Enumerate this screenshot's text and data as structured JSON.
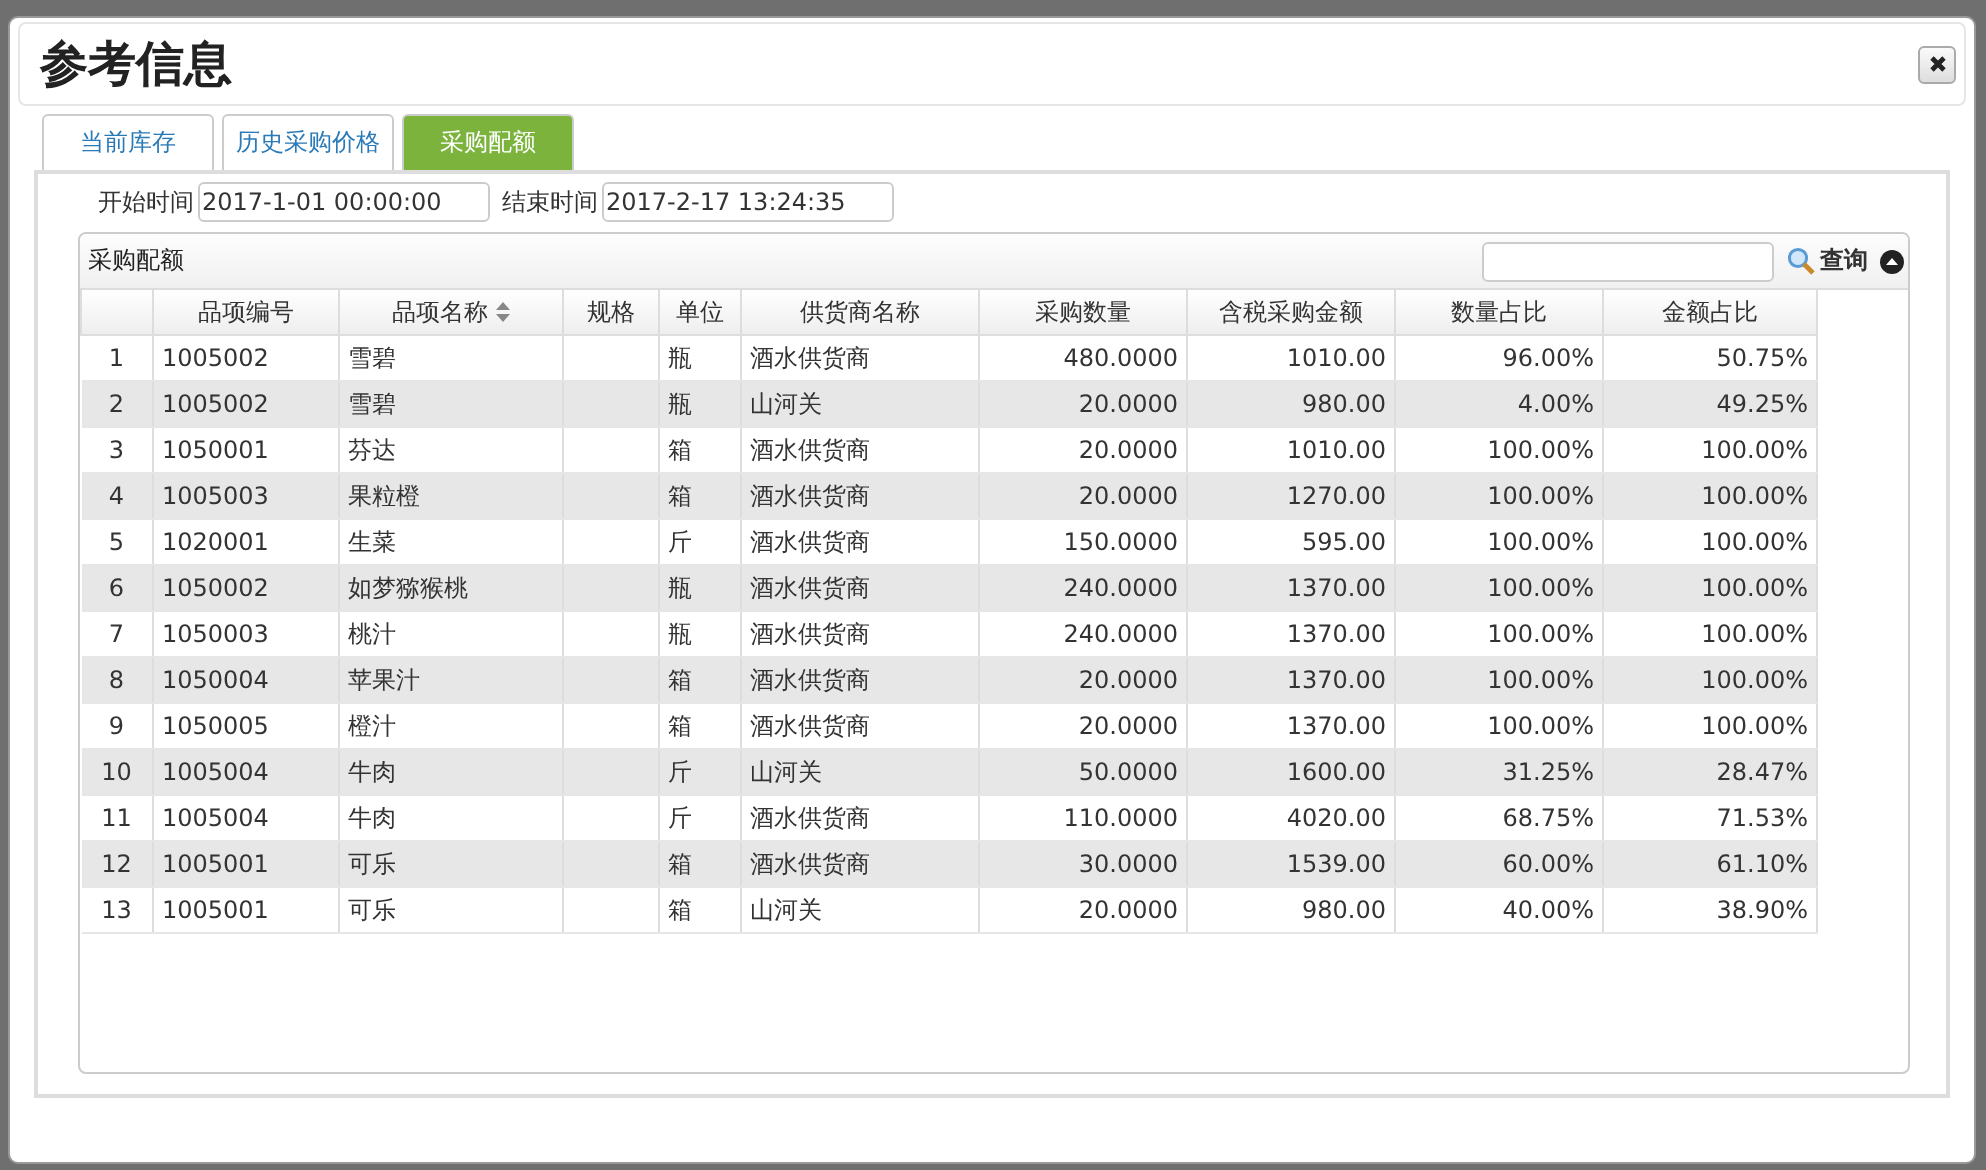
{
  "dialog": {
    "title": "参考信息"
  },
  "tabs": [
    {
      "label": "当前库存",
      "selected": false
    },
    {
      "label": "历史采购价格",
      "selected": false
    },
    {
      "label": "采购配额",
      "selected": true
    }
  ],
  "filters": [
    {
      "label": "开始时间",
      "value": "2017-1-01 00:00:00"
    },
    {
      "label": "结束时间",
      "value": "2017-2-17 13:24:35"
    }
  ],
  "grid": {
    "caption": "采购配额",
    "search_button": "查询",
    "columns": [
      {
        "sortable": false
      },
      {
        "label": "品项编号",
        "sortable": false
      },
      {
        "label": "品项名称",
        "sortable": true
      },
      {
        "label": "规格",
        "sortable": false
      },
      {
        "label": "单位",
        "sortable": false
      },
      {
        "label": "供货商名称",
        "sortable": false
      },
      {
        "label": "采购数量",
        "sortable": false
      },
      {
        "label": "含税采购金额",
        "sortable": false
      },
      {
        "label": "数量占比",
        "sortable": false
      },
      {
        "label": "金额占比",
        "sortable": false
      }
    ],
    "rows": [
      [
        "1",
        "1005002",
        "雪碧",
        "",
        "瓶",
        "酒水供货商",
        "480.0000",
        "1010.00",
        "96.00%",
        "50.75%"
      ],
      [
        "2",
        "1005002",
        "雪碧",
        "",
        "瓶",
        "山河关",
        "20.0000",
        "980.00",
        "4.00%",
        "49.25%"
      ],
      [
        "3",
        "1050001",
        "芬达",
        "",
        "箱",
        "酒水供货商",
        "20.0000",
        "1010.00",
        "100.00%",
        "100.00%"
      ],
      [
        "4",
        "1005003",
        "果粒橙",
        "",
        "箱",
        "酒水供货商",
        "20.0000",
        "1270.00",
        "100.00%",
        "100.00%"
      ],
      [
        "5",
        "1020001",
        "生菜",
        "",
        "斤",
        "酒水供货商",
        "150.0000",
        "595.00",
        "100.00%",
        "100.00%"
      ],
      [
        "6",
        "1050002",
        "如梦猕猴桃",
        "",
        "瓶",
        "酒水供货商",
        "240.0000",
        "1370.00",
        "100.00%",
        "100.00%"
      ],
      [
        "7",
        "1050003",
        "桃汁",
        "",
        "瓶",
        "酒水供货商",
        "240.0000",
        "1370.00",
        "100.00%",
        "100.00%"
      ],
      [
        "8",
        "1050004",
        "苹果汁",
        "",
        "箱",
        "酒水供货商",
        "20.0000",
        "1370.00",
        "100.00%",
        "100.00%"
      ],
      [
        "9",
        "1050005",
        "橙汁",
        "",
        "箱",
        "酒水供货商",
        "20.0000",
        "1370.00",
        "100.00%",
        "100.00%"
      ],
      [
        "10",
        "1005004",
        "牛肉",
        "",
        "斤",
        "山河关",
        "50.0000",
        "1600.00",
        "31.25%",
        "28.47%"
      ],
      [
        "11",
        "1005004",
        "牛肉",
        "",
        "斤",
        "酒水供货商",
        "110.0000",
        "4020.00",
        "68.75%",
        "71.53%"
      ],
      [
        "12",
        "1005001",
        "可乐",
        "",
        "箱",
        "酒水供货商",
        "30.0000",
        "1539.00",
        "60.00%",
        "61.10%"
      ],
      [
        "13",
        "1005001",
        "可乐",
        "",
        "箱",
        "山河关",
        "20.0000",
        "980.00",
        "40.00%",
        "38.90%"
      ]
    ]
  }
}
